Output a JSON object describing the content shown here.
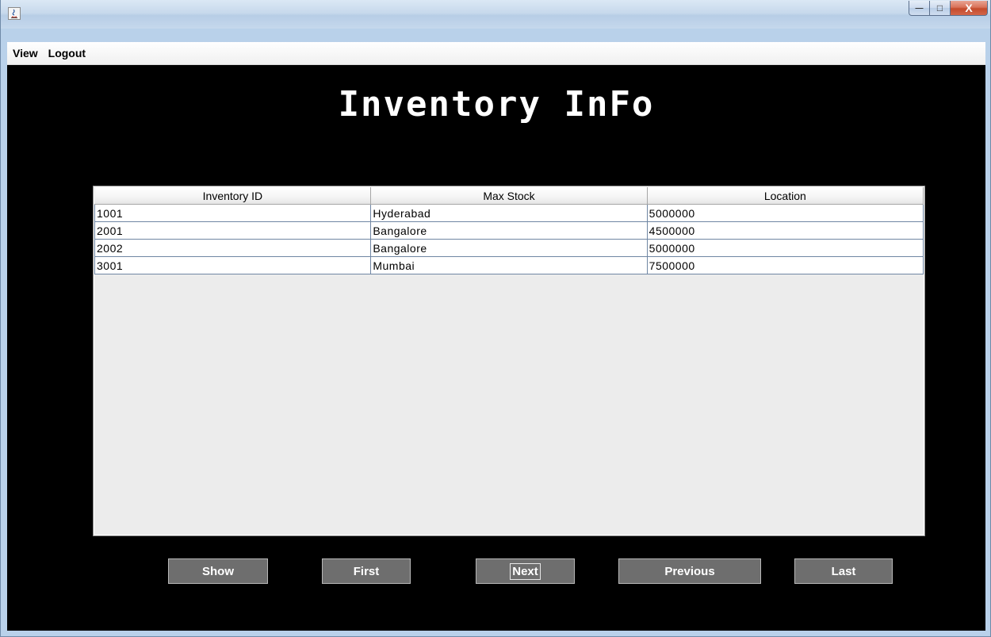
{
  "window": {
    "minimize_symbol": "—",
    "maximize_symbol": "□",
    "close_symbol": "X"
  },
  "menu": {
    "items": [
      "View",
      "Logout"
    ]
  },
  "main": {
    "heading": "Inventory InFo",
    "table": {
      "columns": [
        "Inventory ID",
        "Max Stock",
        "Location"
      ],
      "rows": [
        [
          "1001",
          "Hyderabad",
          "5000000"
        ],
        [
          "2001",
          "Bangalore",
          "4500000"
        ],
        [
          "2002",
          "Bangalore",
          "5000000"
        ],
        [
          "3001",
          "Mumbai",
          "7500000"
        ]
      ]
    },
    "buttons": [
      "Show",
      "First",
      "Next",
      "Previous",
      "Last"
    ],
    "focused_button": "Next"
  },
  "colors": {
    "content_background": "#000000",
    "button_background": "#6e6e6e",
    "title_bar": "#c7d9ec",
    "close_button": "#c44b2c"
  }
}
